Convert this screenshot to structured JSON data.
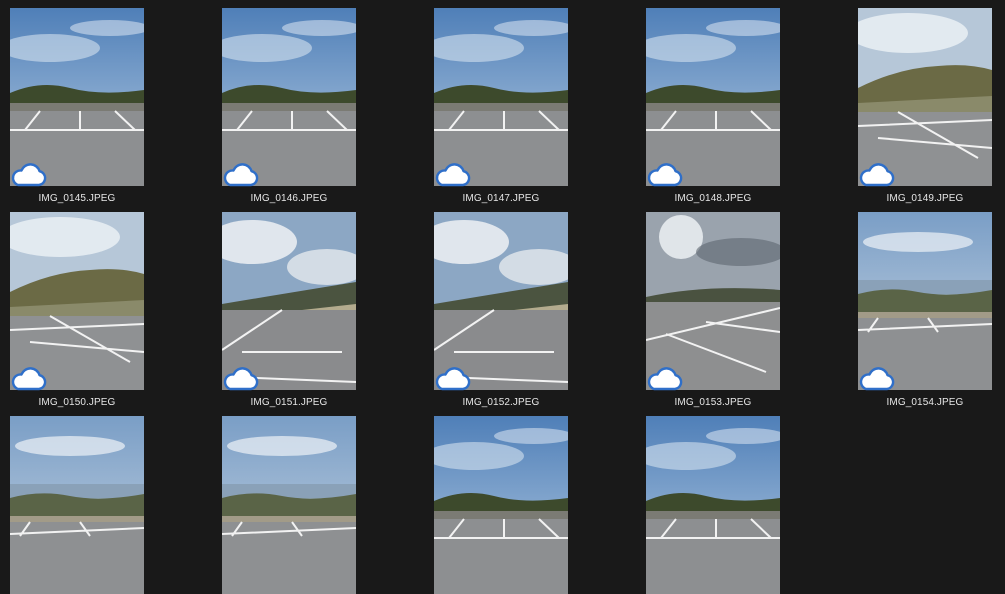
{
  "view": "large-icons",
  "status_icon": "cloud-icon",
  "files": [
    {
      "name": "IMG_0145.JPEG",
      "synced": true,
      "scene": "lot"
    },
    {
      "name": "IMG_0146.JPEG",
      "synced": true,
      "scene": "lot"
    },
    {
      "name": "IMG_0147.JPEG",
      "synced": true,
      "scene": "lot"
    },
    {
      "name": "IMG_0148.JPEG",
      "synced": true,
      "scene": "lot"
    },
    {
      "name": "IMG_0149.JPEG",
      "synced": true,
      "scene": "hill"
    },
    {
      "name": "IMG_0150.JPEG",
      "synced": true,
      "scene": "hill"
    },
    {
      "name": "IMG_0151.JPEG",
      "synced": true,
      "scene": "road"
    },
    {
      "name": "IMG_0152.JPEG",
      "synced": true,
      "scene": "road"
    },
    {
      "name": "IMG_0153.JPEG",
      "synced": true,
      "scene": "sunlot"
    },
    {
      "name": "IMG_0154.JPEG",
      "synced": true,
      "scene": "sea"
    },
    {
      "name": "",
      "synced": false,
      "scene": "sea"
    },
    {
      "name": "",
      "synced": false,
      "scene": "sea"
    },
    {
      "name": "",
      "synced": false,
      "scene": "lot"
    },
    {
      "name": "",
      "synced": false,
      "scene": "lot"
    }
  ]
}
